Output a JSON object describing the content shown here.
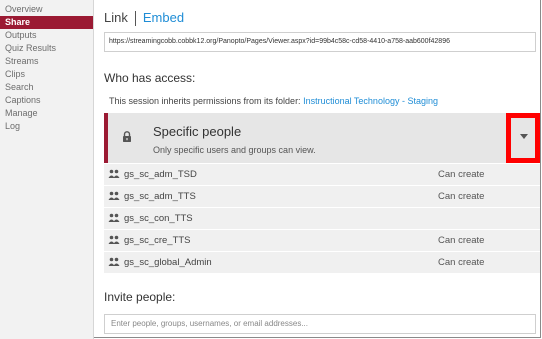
{
  "sidebar": {
    "items": [
      {
        "label": "Overview",
        "active": false
      },
      {
        "label": "Share",
        "active": true
      },
      {
        "label": "Outputs",
        "active": false
      },
      {
        "label": "Quiz Results",
        "active": false
      },
      {
        "label": "Streams",
        "active": false
      },
      {
        "label": "Clips",
        "active": false
      },
      {
        "label": "Search",
        "active": false
      },
      {
        "label": "Captions",
        "active": false
      },
      {
        "label": "Manage",
        "active": false
      },
      {
        "label": "Log",
        "active": false
      }
    ]
  },
  "tabs": {
    "link": "Link",
    "embed": "Embed"
  },
  "link_url": "https://streamingcobb.cobbk12.org/Panopto/Pages/Viewer.aspx?id=99b4c58c-cd58-4410-a758-aab600f42896",
  "access": {
    "heading": "Who has access:",
    "inherit_text": "This session inherits permissions from its folder: ",
    "folder_name": "Instructional Technology - Staging",
    "level_title": "Specific people",
    "level_desc": "Only specific users and groups can view."
  },
  "groups": [
    {
      "name": "gs_sc_adm_TSD",
      "permission": "Can create"
    },
    {
      "name": "gs_sc_adm_TTS",
      "permission": "Can create"
    },
    {
      "name": "gs_sc_con_TTS",
      "permission": ""
    },
    {
      "name": "gs_sc_cre_TTS",
      "permission": "Can create"
    },
    {
      "name": "gs_sc_global_Admin",
      "permission": "Can create"
    }
  ],
  "invite": {
    "heading": "Invite people:",
    "placeholder": "Enter people, groups, usernames, or email addresses..."
  },
  "colors": {
    "accent": "#9b1a33",
    "link": "#1f8dd6",
    "highlight": "#ff0000"
  },
  "icons": {
    "lock": "lock-icon",
    "group": "group-icon",
    "dropdown": "caret-down-icon"
  }
}
